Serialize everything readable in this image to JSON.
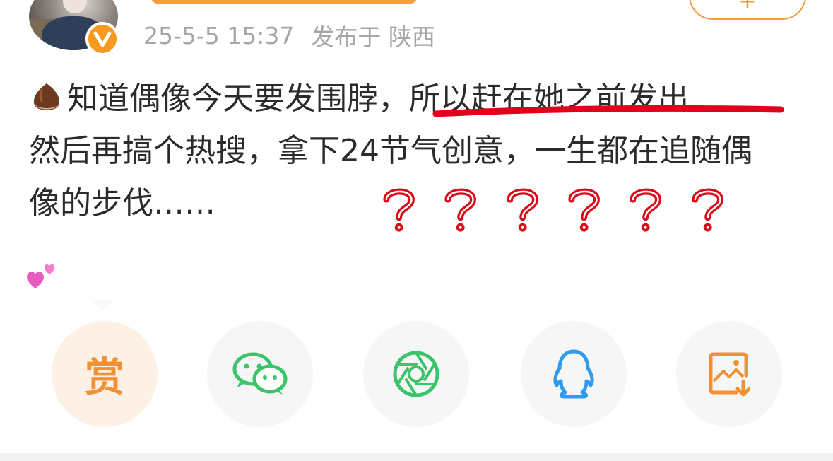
{
  "header": {
    "avatar_icon": "avatar-photo",
    "verified_icon": "verified-v-badge",
    "timestamp": "25-5-5 15:37",
    "published_in": "发布于 陕西"
  },
  "post": {
    "emoji_start": "chestnut-emoji",
    "line1_text": "知道偶像今天要发围脖，所以赶在她之前发出",
    "line2_text": "然后再搞个热搜，拿下24节气创意，一生都在追随偶",
    "line3_text": "像的步伐……",
    "annotation_underline_color": "#e0001b",
    "annotation_question_marks": [
      "?",
      "?",
      "?",
      "?",
      "?",
      "?"
    ],
    "annotation_color": "#d80d1c",
    "emoji_end": "two-hearts-emoji"
  },
  "share": {
    "tip_label": "赏",
    "buttons": [
      {
        "name": "tip",
        "icon": "tip-icon",
        "color": "#f29036"
      },
      {
        "name": "wechat",
        "icon": "wechat-icon",
        "color": "#3cc46a"
      },
      {
        "name": "moments",
        "icon": "wechat-moments-icon",
        "color": "#3cc46a"
      },
      {
        "name": "qq",
        "icon": "qq-icon",
        "color": "#2f9bea"
      },
      {
        "name": "save-image",
        "icon": "save-image-icon",
        "color": "#f29036"
      }
    ]
  }
}
